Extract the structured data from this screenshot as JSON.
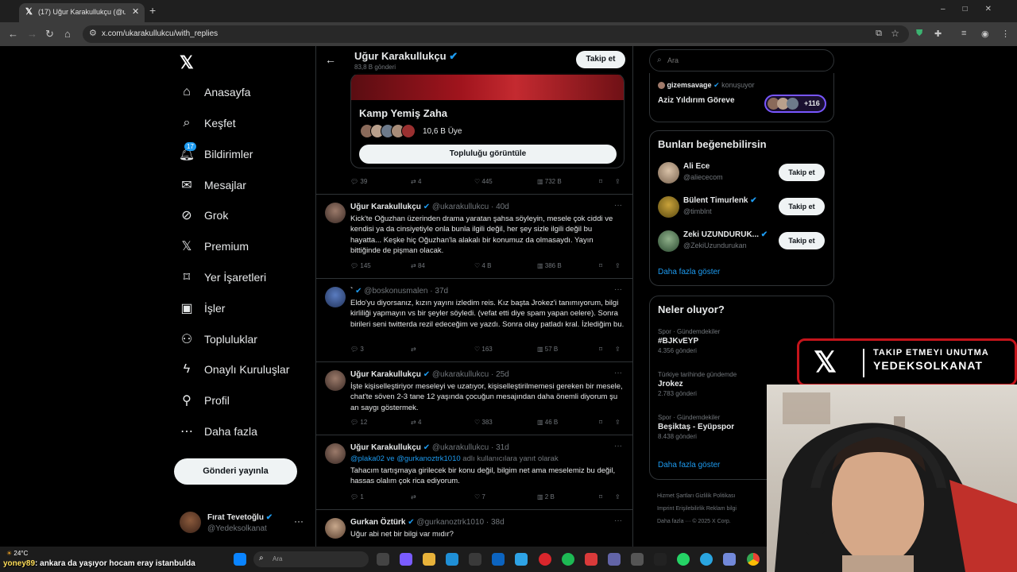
{
  "browser": {
    "tab_title": "(17) Uğur Karakullukçu (@ukara",
    "url": "x.com/ukarakullukcu/with_replies"
  },
  "nav": {
    "items": [
      {
        "label": "Anasayfa",
        "icon": "home-icon"
      },
      {
        "label": "Keşfet",
        "icon": "search-icon"
      },
      {
        "label": "Bildirimler",
        "icon": "bell-icon",
        "badge": "17"
      },
      {
        "label": "Mesajlar",
        "icon": "mail-icon"
      },
      {
        "label": "Grok",
        "icon": "grok-icon"
      },
      {
        "label": "Premium",
        "icon": "x-icon"
      },
      {
        "label": "Yer İşaretleri",
        "icon": "bookmark-icon"
      },
      {
        "label": "İşler",
        "icon": "briefcase-icon"
      },
      {
        "label": "Topluluklar",
        "icon": "people-icon"
      },
      {
        "label": "Onaylı Kuruluşlar",
        "icon": "bolt-icon"
      },
      {
        "label": "Profil",
        "icon": "person-icon"
      },
      {
        "label": "Daha fazla",
        "icon": "more-circle-icon"
      }
    ],
    "post_button": "Gönderi yayınla",
    "me": {
      "name": "Fırat Tevetoğlu",
      "handle": "@Yedeksolkanat"
    }
  },
  "profile": {
    "name": "Uğur Karakullukçu",
    "posts_count": "83,8 B gönderi",
    "follow": "Takip et"
  },
  "community": {
    "title": "Kamp Yemiş Zaha",
    "members": "10,6 B Üye",
    "view_button": "Topluluğu görüntüle",
    "stats": {
      "replies": "39",
      "reposts": "4",
      "likes": "445",
      "views": "732 B"
    }
  },
  "posts": [
    {
      "name": "Uğur Karakullukçu",
      "handle": "@ukarakullukcu",
      "time": "40d",
      "text": "Kick'te Oğuzhan üzerinden drama yaratan şahsa söyleyin, mesele çok ciddi ve kendisi ya da cinsiyetiyle onla bunla ilgili değil, her şey sizle ilgili değil bu hayatta... Keşke hiç Oğuzhan'la alakalı bir konumuz da olmasaydı. Yayın bittiğinde de pişman olacak.",
      "stats": {
        "replies": "145",
        "reposts": "84",
        "likes": "4 B",
        "views": "386 B"
      }
    },
    {
      "name": "`",
      "handle": "@boskonusmalen",
      "time": "37d",
      "text": "Eldo'yu diyorsanız, kızın yayını izledim reis. Kız başta Jrokez'i tanımıyorum, bilgi kirliliği yapmayın vs bir şeyler söyledi. (vefat etti diye spam yapan oelere). Sonra birileri seni twitterda rezil edeceğim ve yazdı. Sonra olay patladı kral. İzlediğim bu.",
      "stats": {
        "replies": "3",
        "reposts": "",
        "likes": "163",
        "views": "57 B"
      }
    },
    {
      "name": "Uğur Karakullukçu",
      "handle": "@ukarakullukcu",
      "time": "25d",
      "text": "İşte kişiselleştiriyor meseleyi ve uzatıyor, kişiselleştirilmemesi gereken bir mesele, chat'te söven 2-3 tane 12 yaşında çocuğun mesajından daha önemli diyorum şu an saygı göstermek.",
      "stats": {
        "replies": "12",
        "reposts": "4",
        "likes": "383",
        "views": "46 B"
      }
    },
    {
      "name": "Uğur Karakullukçu",
      "handle": "@ukarakullukcu",
      "time": "31d",
      "reply_to": "@plaka02 ve @gurkanoztrk1010",
      "reply_suffix": "adlı kullanıcılara yanıt olarak",
      "text": "Tahacım tartışmaya girilecek bir konu değil, bilgim net ama meselemiz bu değil, hassas olalım çok rica ediyorum.",
      "stats": {
        "replies": "1",
        "reposts": "",
        "likes": "7",
        "views": "2 B"
      }
    },
    {
      "name": "Gurkan Öztürk",
      "handle": "@gurkanoztrk1010",
      "time": "38d",
      "text": "Uğur abi net bir bilgi var mıdır?"
    }
  ],
  "right": {
    "search_placeholder": "Ara",
    "spaces": {
      "host": "gizemsavage",
      "speaking": "konuşuyor",
      "title": "Aziz Yıldırım Göreve",
      "count": "+116"
    },
    "who_to_follow": {
      "title": "Bunları beğenebilirsin",
      "users": [
        {
          "name": "Ali Ece",
          "handle": "@aliececom"
        },
        {
          "name": "Bülent Timurlenk",
          "handle": "@timblnt"
        },
        {
          "name": "Zeki UZUNDURUK...",
          "handle": "@ZekiUzundurukan"
        }
      ],
      "follow": "Takip et",
      "more": "Daha fazla göster"
    },
    "trends": {
      "title": "Neler oluyor?",
      "items": [
        {
          "category": "Spor · Gündemdekiler",
          "title": "#BJKvEYP",
          "count": "4.356 gönderi"
        },
        {
          "category": "Türkiye tarihinde gündemde",
          "title": "Jrokez",
          "count": "2.783 gönderi"
        },
        {
          "category": "Spor · Gündemdekiler",
          "title": "Beşiktaş - Eyüpspor",
          "count": "8.438 gönderi"
        }
      ],
      "more": "Daha fazla göster"
    },
    "footer": {
      "l1": "Hizmet Şartları   Gizlilik Politikası",
      "l2": "Imprint   Erişilebilirlik   Reklam bilgi",
      "l3": "Daha fazla ···  © 2025 X Corp."
    }
  },
  "overlay": {
    "line1": "TAKIP ETMEYI UNUTMA",
    "line2": "YEDEKSOLKANAT"
  },
  "taskbar": {
    "temp": "24°C",
    "search_placeholder": "Ara"
  },
  "chat": {
    "user": "yoney89",
    "message": ": ankara da yaşıyor hocam eray istanbulda"
  }
}
